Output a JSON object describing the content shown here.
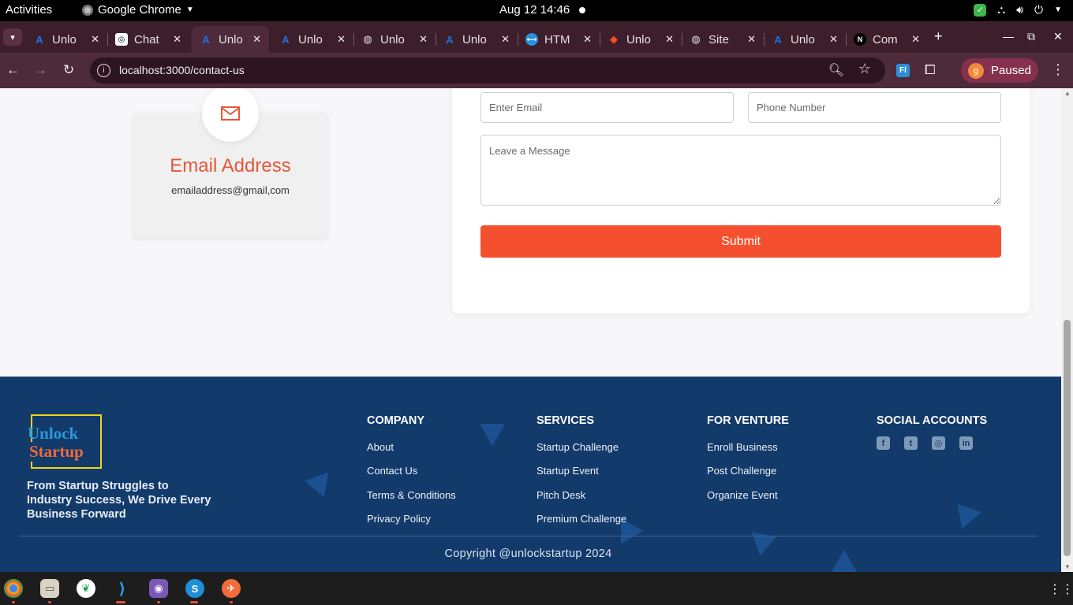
{
  "topbar": {
    "activities": "Activities",
    "app_name": "Google Chrome",
    "clock": "Aug 12  14:46"
  },
  "tabs": [
    {
      "title": "Unlo",
      "icon": "a-logo-icon",
      "active": false
    },
    {
      "title": "Chat",
      "icon": "chatgpt-icon",
      "active": false
    },
    {
      "title": "Unlo",
      "icon": "a-logo-icon",
      "active": true
    },
    {
      "title": "Unlo",
      "icon": "a-logo-icon",
      "active": false
    },
    {
      "title": "Unlo",
      "icon": "globe-icon",
      "active": false
    },
    {
      "title": "Unlo",
      "icon": "a-logo-icon",
      "active": false
    },
    {
      "title": "HTM",
      "icon": "html-icon",
      "active": false
    },
    {
      "title": "Unlo",
      "icon": "figma-icon",
      "active": false
    },
    {
      "title": "Site",
      "icon": "globe-icon",
      "active": false
    },
    {
      "title": "Unlo",
      "icon": "a-logo-icon",
      "active": false
    },
    {
      "title": "Com",
      "icon": "next-icon",
      "active": false
    }
  ],
  "addressbar": {
    "url": "localhost:3000/contact-us",
    "profile_label": "Paused",
    "profile_initial": "g"
  },
  "contact": {
    "email_title": "Email Address",
    "email_value": "emailaddress@gmail,com"
  },
  "form": {
    "email_placeholder": "Enter Email",
    "phone_placeholder": "Phone Number",
    "message_placeholder": "Leave a Message",
    "submit_label": "Submit"
  },
  "footer": {
    "logo_line1": "Unlock",
    "logo_line2": "Startup",
    "tagline": "From Startup Struggles to Industry Success, We Drive Every Business Forward",
    "company": {
      "heading": "COMPANY",
      "links": [
        "About",
        "Contact Us",
        "Terms & Conditions",
        "Privacy Policy"
      ]
    },
    "services": {
      "heading": "SERVICES",
      "links": [
        "Startup Challenge",
        "Startup Event",
        "Pitch Desk",
        "Premium Challenge"
      ]
    },
    "venture": {
      "heading": "FOR VENTURE",
      "links": [
        "Enroll Business",
        "Post Challenge",
        "Organize Event"
      ]
    },
    "social": {
      "heading": "SOCIAL ACCOUNTS",
      "icons": [
        "facebook-icon",
        "twitter-icon",
        "instagram-icon",
        "linkedin-icon"
      ]
    },
    "copyright": "Copyright @unlockstartup 2024"
  },
  "colors": {
    "accent": "#f4502f",
    "footer_bg": "#123a6b",
    "chrome_frame": "#4d2b3a"
  }
}
